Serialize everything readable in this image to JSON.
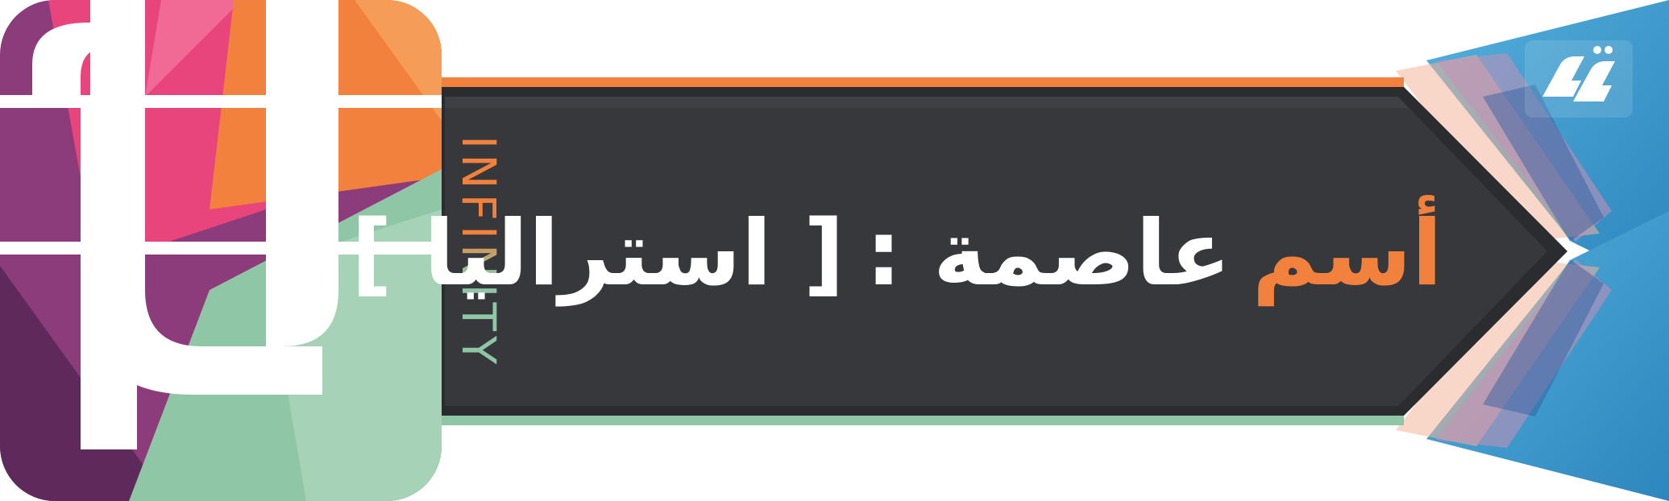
{
  "banner": {
    "vertical_text": "INFINITY",
    "title_highlight": "أسم",
    "title_main": "عاصمة :",
    "title_answer": "[ استراليا ]"
  },
  "logo": {
    "letters": "it"
  },
  "corner_logo": {
    "icon": "brand-mark-icon"
  },
  "colors": {
    "dark_panel": "#37383c",
    "orange": "#f2813d",
    "mint": "#8fc6a5",
    "pink": "#e9457d",
    "purple": "#8c3b7b",
    "blue": "#3d9acb",
    "white": "#ffffff"
  }
}
